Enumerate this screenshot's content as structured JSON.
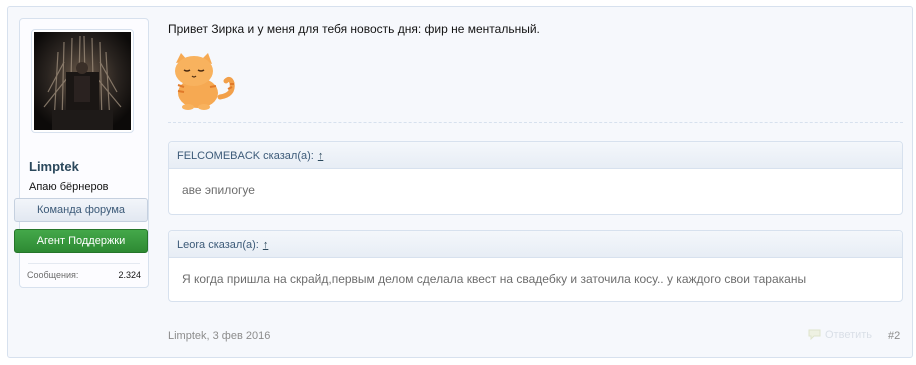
{
  "user": {
    "username": "Limptek",
    "title": "Апаю бёрнеров",
    "banner_team": "Команда форума",
    "banner_support": "Агент Поддержки",
    "messages_label": "Сообщения:",
    "messages_count": "2.324"
  },
  "message": {
    "text": "Привет Зирка и у меня для тебя новость дня: фир не ментальный.",
    "quotes": [
      {
        "author": "FELCOMEBACK сказал(а):",
        "up": "↑",
        "text": "аве эпилогуе"
      },
      {
        "author": "Leora сказал(а):",
        "up": "↑",
        "text": "Я когда пришла на скрайд,первым делом сделала квест на свадебку и заточила косу.. у каждого свои тараканы"
      }
    ]
  },
  "footer": {
    "author_date": "Limptek, 3 фев 2016",
    "reply_label": "Ответить",
    "post_number": "#2"
  },
  "colors": {
    "accent": "#2b485c",
    "support_green": "#3a9a40",
    "border": "#d7e1ee"
  }
}
